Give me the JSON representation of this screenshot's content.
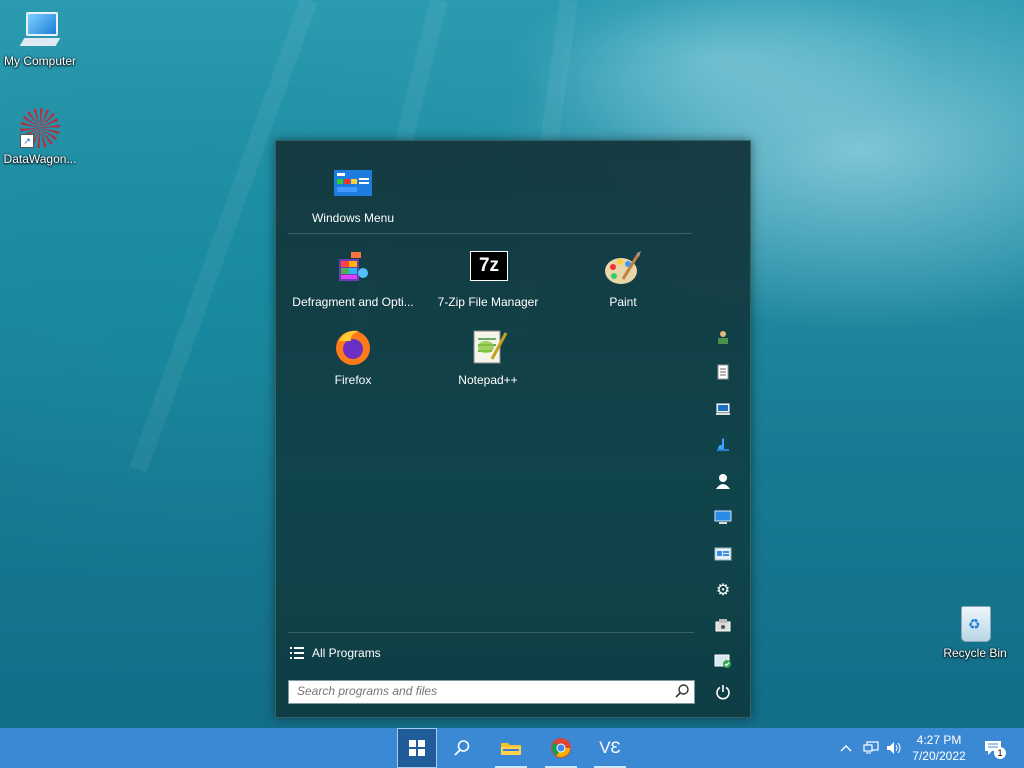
{
  "desktop": {
    "icons": [
      {
        "label": "My Computer"
      },
      {
        "label": "DataWagon..."
      },
      {
        "label": "Recycle Bin"
      }
    ]
  },
  "start_menu": {
    "pinned_top": {
      "label": "Windows Menu"
    },
    "apps": [
      {
        "label": "Defragment and Opti..."
      },
      {
        "label": "7-Zip File Manager"
      },
      {
        "label": "Paint"
      },
      {
        "label": "Firefox"
      },
      {
        "label": "Notepad++"
      }
    ],
    "side_icons": [
      "user-folder-icon",
      "documents-icon",
      "computer-icon",
      "music-icon",
      "user-icon",
      "network-icon",
      "control-panel-icon",
      "settings-icon",
      "devices-icon",
      "security-icon",
      "power-icon"
    ],
    "all_programs_label": "All Programs",
    "search_placeholder": "Search programs and files",
    "sevenzip_glyph": "7z"
  },
  "taskbar": {
    "buttons": [
      "start-button",
      "search-button",
      "file-explorer-button",
      "chrome-button",
      "ve-app-button"
    ],
    "ve_label": "VƐ",
    "clock": {
      "time": "4:27 PM",
      "date": "7/20/2022"
    },
    "notification_count": "1"
  },
  "colors": {
    "taskbar": "#3b89d4",
    "menu_bg": "#14373e",
    "accent": "#1d7fd1"
  }
}
